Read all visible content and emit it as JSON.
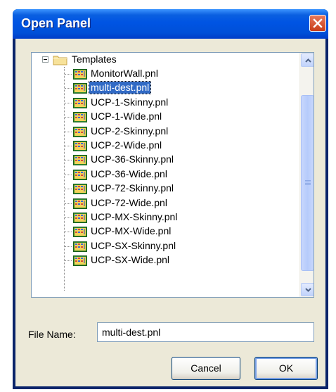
{
  "dialog": {
    "title": "Open Panel"
  },
  "tree": {
    "root": {
      "label": "Templates",
      "expanded": true
    },
    "selected_index": 1,
    "items": [
      "MonitorWall.pnl",
      "multi-dest.pnl",
      "UCP-1-Skinny.pnl",
      "UCP-1-Wide.pnl",
      "UCP-2-Skinny.pnl",
      "UCP-2-Wide.pnl",
      "UCP-36-Skinny.pnl",
      "UCP-36-Wide.pnl",
      "UCP-72-Skinny.pnl",
      "UCP-72-Wide.pnl",
      "UCP-MX-Skinny.pnl",
      "UCP-MX-Wide.pnl",
      "UCP-SX-Skinny.pnl",
      "UCP-SX-Wide.pnl"
    ]
  },
  "file_name": {
    "label": "File Name:",
    "value": "multi-dest.pnl"
  },
  "buttons": {
    "cancel": "Cancel",
    "ok": "OK"
  },
  "colors": {
    "titlebar": "#0054e3",
    "selection": "#316ac5",
    "close": "#c93d18"
  },
  "icons": {
    "folder": "folder-icon",
    "file": "panel-file-icon",
    "close": "close-icon"
  }
}
